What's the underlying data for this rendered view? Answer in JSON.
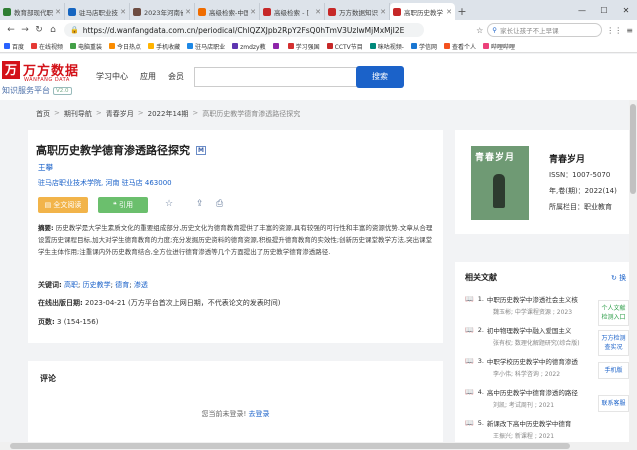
{
  "browser": {
    "tabs": [
      {
        "label": "教育部现代职",
        "color": "#2e7d32",
        "active": false
      },
      {
        "label": "驻马店职业技",
        "color": "#1565c0",
        "active": false
      },
      {
        "label": "2023年河南省",
        "color": "#6d4c41",
        "active": false
      },
      {
        "label": "高级检索-中国",
        "color": "#ef6c00",
        "active": false
      },
      {
        "label": "高级检索 - [",
        "color": "#c62828",
        "active": false
      },
      {
        "label": "万方数据知识",
        "color": "#c62828",
        "active": false
      },
      {
        "label": "高职历史教学",
        "color": "#c62828",
        "active": true
      }
    ],
    "new_tab": "+",
    "url": "https://d.wanfangdata.com.cn/periodical/ChlQZXJpb2RpY2FsQ0hTmV3UzIwMjMxMjI2E",
    "search_placeholder": "家长让孩子不上早课",
    "bookmarks": [
      {
        "label": "百度",
        "color": "#2962ff"
      },
      {
        "label": "在线视频",
        "color": "#e53935"
      },
      {
        "label": "电脑重装",
        "color": "#43a047"
      },
      {
        "label": "今日热点",
        "color": "#fb8c00"
      },
      {
        "label": "手机收藏",
        "color": "#ffb300"
      },
      {
        "label": "驻马店职业",
        "color": "#1e88e5"
      },
      {
        "label": "zmdzy教",
        "color": "#5e35b1"
      },
      {
        "label": "",
        "color": "#8e24aa"
      },
      {
        "label": "学习强国",
        "color": "#d32f2f"
      },
      {
        "label": "CCTV节目",
        "color": "#c62828"
      },
      {
        "label": "咪咕视频-",
        "color": "#00897b"
      },
      {
        "label": "学信网",
        "color": "#1976d2"
      },
      {
        "label": "查看个人",
        "color": "#f4511e"
      },
      {
        "label": "哔哩哔哩",
        "color": "#ec407a"
      }
    ]
  },
  "site": {
    "logo_cn": "万方数据",
    "logo_en": "WANFANG DATA",
    "logo_sub": "知识服务平台",
    "logo_version": "V2.0",
    "nav": [
      "学习中心",
      "应用",
      "会员"
    ],
    "search_button": "搜索"
  },
  "breadcrumb": [
    "首页",
    "期刊导航",
    "青春岁月",
    "2022年14期",
    "高职历史教学德育渗透路径探究"
  ],
  "article": {
    "title": "高职历史教学德育渗透路径探究",
    "badge": "M",
    "author": "王攀",
    "affiliation": "驻马店职业技术学院, 河南 驻马店 463000",
    "fulltext_button": "全文阅读",
    "cite_button": "引用",
    "abstract_label": "摘要:",
    "abstract": "历史教学是大学生素质文化的重要组成部分,历史文化为德育教育提供了丰富的资源,具有较强的可行性和丰富的资源优势.文章从合理设置历史课程目标,加大对学生德育教育的力度;充分发掘历史资料的德育资源,积极提升德育教育的实效性;创新历史课堂教学方法,突出课堂学生主体作用;注重课内外历史教育结合,全方位进行德育渗透等几个方面提出了历史教学德育渗透路径.",
    "keywords_label": "关键词:",
    "keywords": [
      "高职",
      "历史教学",
      "德育",
      "渗透"
    ],
    "date_label": "在线出版日期:",
    "date": "2023-04-21",
    "date_note": "(万方平台首次上网日期，不代表论文的发表时间)",
    "pages_label": "页数:",
    "pages": "3 (154-156)"
  },
  "comment": {
    "title": "评论",
    "login_text": "您当前未登录!",
    "login_link": "去登录"
  },
  "journal": {
    "cover_title": "青春岁月",
    "name": "青春岁月",
    "issn": "ISSN：1007-5070",
    "issue": "年,卷(期)：2022(14)",
    "column": "所属栏目：职业教育"
  },
  "related": {
    "title": "相关文献",
    "refresh": "换",
    "items": [
      {
        "num": "1.",
        "title": "中职历史教学中渗透社会主义核",
        "sub": "魏玉彬; 中学课程资源 ; 2023"
      },
      {
        "num": "2.",
        "title": "初中物理教学中融入爱国主义",
        "sub": "张有权; 数理化解题研究(综合版)"
      },
      {
        "num": "3.",
        "title": "中职学校历史教学中的德育渗透",
        "sub": "李小伟; 科学咨询 ; 2022"
      },
      {
        "num": "4.",
        "title": "高中历史教学中德育渗透的路径",
        "sub": "刘凯; 考试周刊 ; 2021"
      },
      {
        "num": "5.",
        "title": "新课改下高中历史教学中德育",
        "sub": "王振兴; 新课程 ; 2021"
      }
    ]
  },
  "sidetools": {
    "t1": "个人文献检测入口",
    "t2": "万方检测查实况",
    "t3": "手机版",
    "t4": "联系客服"
  }
}
